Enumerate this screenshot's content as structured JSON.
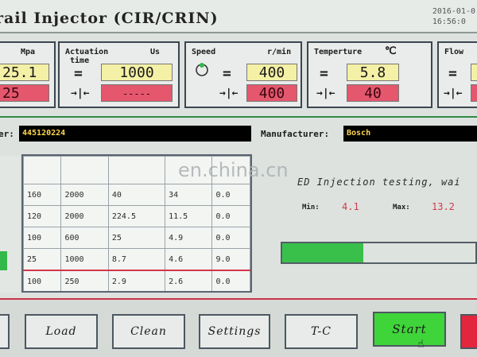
{
  "header": {
    "title": "rail Injector (CIR/CRIN)",
    "date": "2016-01-0",
    "time": "16:56:0"
  },
  "panels": {
    "pressure": {
      "unit": "Mpa",
      "set": "25.1",
      "actual": "25"
    },
    "actuation": {
      "label": "Actuation\n time",
      "unit": "Us",
      "set": "1000",
      "actual": "-----"
    },
    "speed": {
      "label": "Speed",
      "unit": "r/min",
      "set": "400",
      "actual": "400"
    },
    "temperature": {
      "label": "Temperture",
      "unit": "℃",
      "set": "5.8",
      "actual": "40"
    },
    "flow": {
      "label": "Flow"
    }
  },
  "symbols": {
    "equal": "=",
    "clamp": "→|←"
  },
  "info": {
    "number_label": "er:",
    "number_value": "445120224",
    "manufacturer_label": "Manufacturer:",
    "manufacturer_value": "Bosch"
  },
  "table": {
    "rows": [
      [
        "160",
        "2000",
        "40",
        "34",
        "0.0"
      ],
      [
        "120",
        "2000",
        "224.5",
        "11.5",
        "0.0"
      ],
      [
        "100",
        "600",
        "25",
        "4.9",
        "0.0"
      ],
      [
        "25",
        "1000",
        "8.7",
        "4.6",
        "9.0"
      ],
      [
        "100",
        "250",
        "2.9",
        "2.6",
        "0.0"
      ]
    ]
  },
  "status": {
    "text": "ED Injection testing, wai",
    "min_label": "Min:",
    "min_value": "4.1",
    "max_label": "Max:",
    "max_value": "13.2",
    "progress": 0.42
  },
  "buttons": {
    "load": "Load",
    "clean": "Clean",
    "settings": "Settings",
    "tc": "T-C",
    "start": "Start"
  },
  "watermark": "en.china.cn",
  "colors": {
    "accent_green": "#3fd43a",
    "value_yellow": "#f4f0a6",
    "value_red": "#e4576d",
    "stop_red": "#e3263d"
  }
}
